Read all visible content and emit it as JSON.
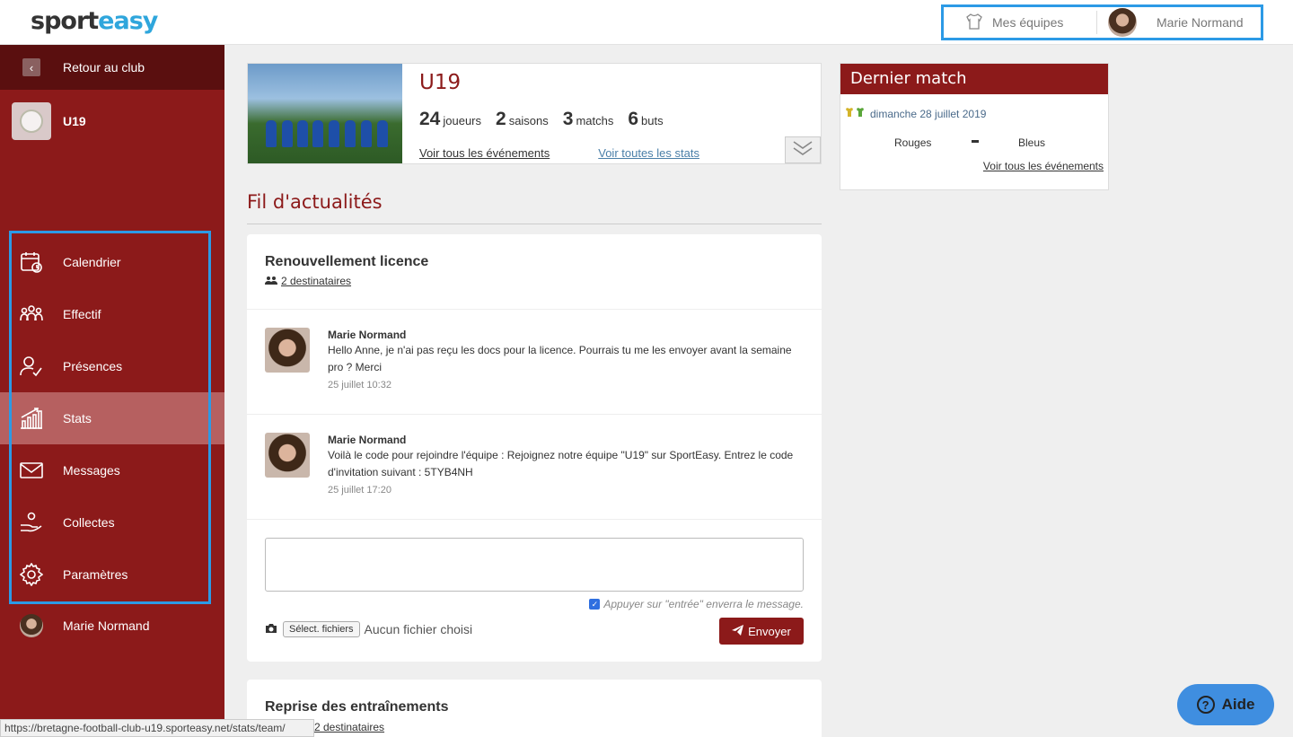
{
  "header": {
    "logo_part1": "sport",
    "logo_part2": "easy",
    "my_teams_label": "Mes équipes",
    "user_name": "Marie Normand"
  },
  "sidebar": {
    "back_label": "Retour au club",
    "team_name": "U19",
    "items": [
      {
        "label": "Calendrier",
        "icon": "calendar-icon"
      },
      {
        "label": "Effectif",
        "icon": "team-icon"
      },
      {
        "label": "Présences",
        "icon": "attendance-icon"
      },
      {
        "label": "Stats",
        "icon": "stats-icon",
        "active": true
      },
      {
        "label": "Messages",
        "icon": "mail-icon"
      },
      {
        "label": "Collectes",
        "icon": "collect-icon"
      },
      {
        "label": "Paramètres",
        "icon": "gear-icon"
      }
    ],
    "user_name": "Marie Normand"
  },
  "team_card": {
    "name": "U19",
    "players_count": "24",
    "players_label": "joueurs",
    "seasons_count": "2",
    "seasons_label": "saisons",
    "matches_count": "3",
    "matches_label": "matchs",
    "goals_count": "6",
    "goals_label": "buts",
    "events_link": "Voir tous les événements",
    "stats_link": "Voir toutes les stats"
  },
  "last_match": {
    "title": "Dernier match",
    "date": "dimanche 28 juillet 2019",
    "team_home": "Rouges",
    "team_away": "Bleus",
    "events_link": "Voir tous les événements"
  },
  "feed": {
    "title": "Fil d'actualités",
    "post1": {
      "title": "Renouvellement licence",
      "recipients": "2 destinataires",
      "messages": [
        {
          "author": "Marie Normand",
          "text": "Hello Anne, je n'ai pas reçu les docs pour la licence. Pourrais tu me les envoyer avant la semaine pro ? Merci",
          "time": "25 juillet 10:32"
        },
        {
          "author": "Marie Normand",
          "text": "Voilà le code pour rejoindre l'équipe : Rejoignez notre équipe \"U19\" sur SportEasy. Entrez le code d'invitation suivant : 5TYB4NH",
          "time": "25 juillet 17:20"
        }
      ],
      "enter_option": "Appuyer sur \"entrée\" enverra le message.",
      "file_button": "Sélect. fichiers",
      "no_file": "Aucun fichier choisi",
      "send_label": "Envoyer"
    },
    "post2": {
      "title": "Reprise des entraînements",
      "recipients": "2 destinataires"
    }
  },
  "status_url": "https://bretagne-football-club-u19.sporteasy.net/stats/team/",
  "help_label": "Aide"
}
